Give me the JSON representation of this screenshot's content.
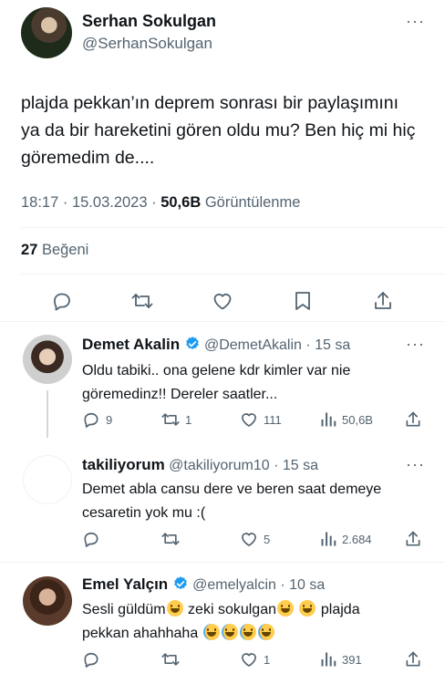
{
  "main_tweet": {
    "author_name": "Serhan Sokulgan",
    "author_handle": "@SerhanSokulgan",
    "text": "plajda pekkan’ın deprem sonrası bir paylaşımını ya da bir hareketini gören oldu mu? Ben hiç mi hiç göremedim de....",
    "time": "18:17 · 15.03.2023 · ",
    "views_count": "50,6B",
    "views_label": " Görüntülenme",
    "likes_count": "27",
    "likes_label": " Beğeni"
  },
  "replies": [
    {
      "name": "Demet Akalin",
      "handle": "@DemetAkalin · 15 sa",
      "verified": true,
      "text": "Oldu tabiki.. ona gelene kdr kimler var nie göremedinz!! Dereler saatler...",
      "reply_count": "9",
      "retweet_count": "1",
      "like_count": "111",
      "view_count": "50,6B"
    },
    {
      "name": "takiliyorum",
      "handle": "@takiliyorum10 · 15 sa",
      "verified": false,
      "text": "Demet abla cansu dere ve beren saat demeye cesaretin yok mu  :(",
      "reply_count": "",
      "retweet_count": "",
      "like_count": "5",
      "view_count": "2.684"
    },
    {
      "name": "Emel Yalçın",
      "handle": "@emelyalcin · 10 sa",
      "verified": true,
      "text_a": "Sesli güldüm",
      "text_b": " zeki sokulgan",
      "text_c": " plajda",
      "text_d": "pekkan ahahhaha ",
      "reply_count": "",
      "retweet_count": "",
      "like_count": "1",
      "view_count": "391"
    }
  ],
  "colors": {
    "accent": "#1d9bf0",
    "secondary_text": "#536471",
    "divider": "#eff3f4"
  }
}
